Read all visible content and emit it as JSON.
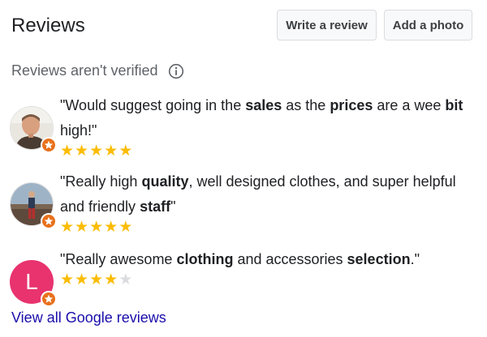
{
  "header": {
    "title": "Reviews",
    "write_review_label": "Write a review",
    "add_photo_label": "Add a photo"
  },
  "notice": {
    "text": "Reviews aren't verified",
    "icon": "info-icon"
  },
  "reviews": [
    {
      "quote_parts": [
        {
          "t": "\"Would suggest going in the ",
          "b": false
        },
        {
          "t": "sales",
          "b": true
        },
        {
          "t": " as the ",
          "b": false
        },
        {
          "t": "prices",
          "b": true
        },
        {
          "t": " are a wee ",
          "b": false
        },
        {
          "t": "bit",
          "b": true
        },
        {
          "t": " high!\"",
          "b": false
        }
      ],
      "rating": 5,
      "avatar": "photo-avatar",
      "badge": "local-guide-badge-icon"
    },
    {
      "quote_parts": [
        {
          "t": "\"Really high ",
          "b": false
        },
        {
          "t": "quality",
          "b": true
        },
        {
          "t": ", well designed clothes, and super helpful and friendly ",
          "b": false
        },
        {
          "t": "staff",
          "b": true
        },
        {
          "t": "\"",
          "b": false
        }
      ],
      "rating": 5,
      "avatar": "photo-avatar",
      "badge": "local-guide-badge-icon"
    },
    {
      "quote_parts": [
        {
          "t": "\"Really awesome ",
          "b": false
        },
        {
          "t": "clothing",
          "b": true
        },
        {
          "t": " and accessories ",
          "b": false
        },
        {
          "t": "selection",
          "b": true
        },
        {
          "t": ".\"",
          "b": false
        }
      ],
      "rating": 4,
      "avatar": "letter-avatar",
      "avatar_letter": "L",
      "avatar_color": "#e8336f",
      "badge": "local-guide-badge-icon"
    }
  ],
  "footer": {
    "view_all_label": "View all Google reviews"
  },
  "colors": {
    "star_on": "#fbbc04",
    "star_off": "#dadce0",
    "badge": "#e8711c",
    "link": "#1a0dab"
  }
}
